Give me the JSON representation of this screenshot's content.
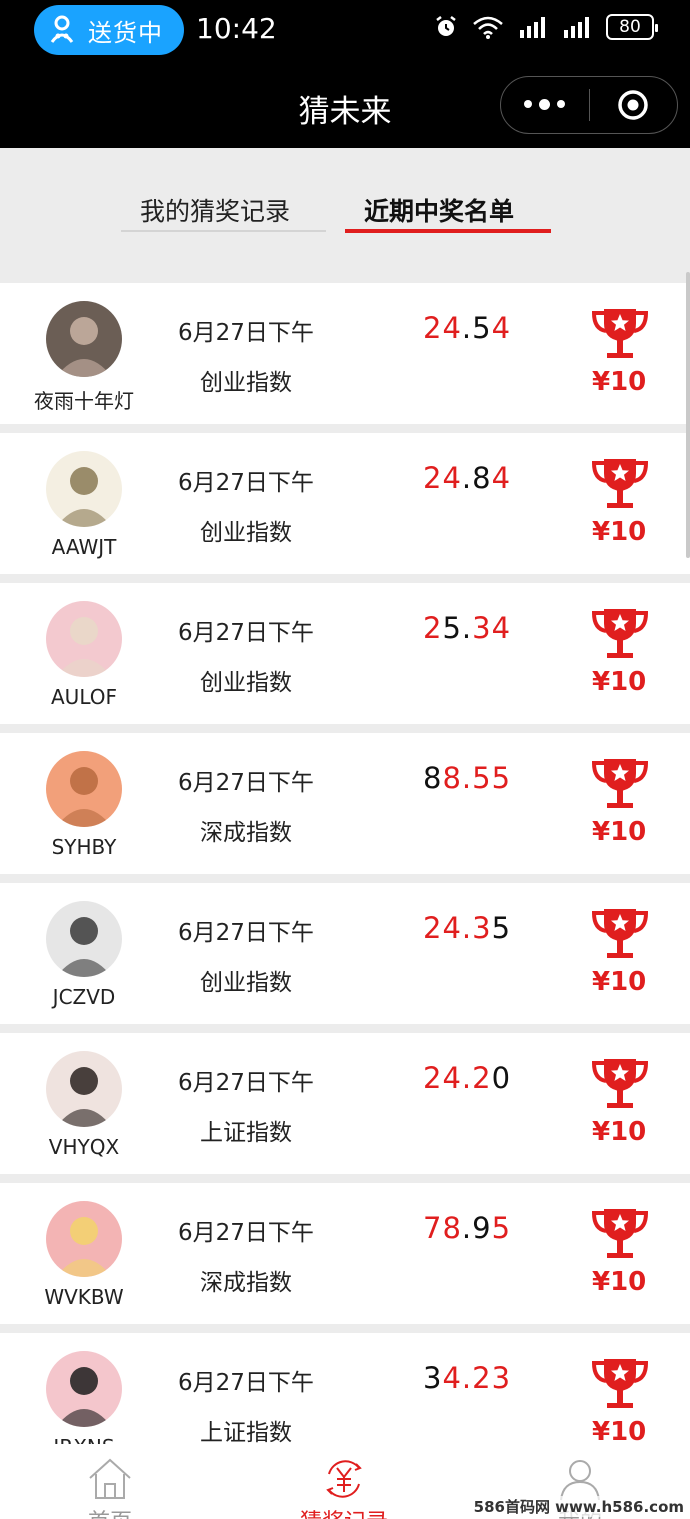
{
  "status_bar": {
    "delivery_label": "送货中",
    "time": "10:42",
    "battery": "80"
  },
  "nav": {
    "title": "猜未来"
  },
  "tabs": [
    {
      "label": "我的猜奖记录",
      "active": false
    },
    {
      "label": "近期中奖名单",
      "active": true
    }
  ],
  "winners": [
    {
      "name": "夜雨十年灯",
      "date": "6月27日下午",
      "index": "创业指数",
      "value_parts": [
        {
          "t": "24",
          "c": "r"
        },
        {
          "t": ".",
          "c": "b"
        },
        {
          "t": "5",
          "c": "b"
        },
        {
          "t": "4",
          "c": "r"
        }
      ],
      "prize": "¥10",
      "avatar_colors": [
        "#6b5e55",
        "#c9b3a5"
      ]
    },
    {
      "name": "AAWJT",
      "date": "6月27日下午",
      "index": "创业指数",
      "value_parts": [
        {
          "t": "24",
          "c": "r"
        },
        {
          "t": ".",
          "c": "b"
        },
        {
          "t": "8",
          "c": "b"
        },
        {
          "t": "4",
          "c": "r"
        }
      ],
      "prize": "¥10",
      "avatar_colors": [
        "#f4efe2",
        "#8a7a55"
      ]
    },
    {
      "name": "AULOF",
      "date": "6月27日下午",
      "index": "创业指数",
      "value_parts": [
        {
          "t": "2",
          "c": "r"
        },
        {
          "t": "5.",
          "c": "b"
        },
        {
          "t": "34",
          "c": "r"
        }
      ],
      "prize": "¥10",
      "avatar_colors": [
        "#f3c9cf",
        "#e7d9c8"
      ]
    },
    {
      "name": "SYHBY",
      "date": "6月27日下午",
      "index": "深成指数",
      "value_parts": [
        {
          "t": "8",
          "c": "b"
        },
        {
          "t": "8.55",
          "c": "r"
        }
      ],
      "prize": "¥10",
      "avatar_colors": [
        "#f2a07a",
        "#b86a40"
      ]
    },
    {
      "name": "JCZVD",
      "date": "6月27日下午",
      "index": "创业指数",
      "value_parts": [
        {
          "t": "24.3",
          "c": "r"
        },
        {
          "t": "5",
          "c": "b"
        }
      ],
      "prize": "¥10",
      "avatar_colors": [
        "#e6e6e6",
        "#3a3a3a"
      ]
    },
    {
      "name": "VHYQX",
      "date": "6月27日下午",
      "index": "上证指数",
      "value_parts": [
        {
          "t": "24.2",
          "c": "r"
        },
        {
          "t": "0",
          "c": "b"
        }
      ],
      "prize": "¥10",
      "avatar_colors": [
        "#efe3df",
        "#2a2220"
      ]
    },
    {
      "name": "WVKBW",
      "date": "6月27日下午",
      "index": "深成指数",
      "value_parts": [
        {
          "t": "78",
          "c": "r"
        },
        {
          "t": ".9",
          "c": "b"
        },
        {
          "t": "5",
          "c": "r"
        }
      ],
      "prize": "¥10",
      "avatar_colors": [
        "#f3b4b4",
        "#f2d36b"
      ]
    },
    {
      "name": "JRXNS",
      "date": "6月27日下午",
      "index": "上证指数",
      "value_parts": [
        {
          "t": "3",
          "c": "b"
        },
        {
          "t": "4.23",
          "c": "r"
        }
      ],
      "prize": "¥10",
      "avatar_colors": [
        "#f4c6cc",
        "#1c1c1c"
      ]
    }
  ],
  "bottom_tabs": [
    {
      "label": "首页",
      "icon": "home-icon"
    },
    {
      "label": "猜奖记录",
      "icon": "yuan-record-icon"
    },
    {
      "label": "我的",
      "icon": "user-icon"
    }
  ],
  "watermark": "586首码网 www.h586.com",
  "colors": {
    "accent_red": "#e01e1e",
    "pill_blue": "#1aa3ff",
    "nav_black": "#000000"
  }
}
